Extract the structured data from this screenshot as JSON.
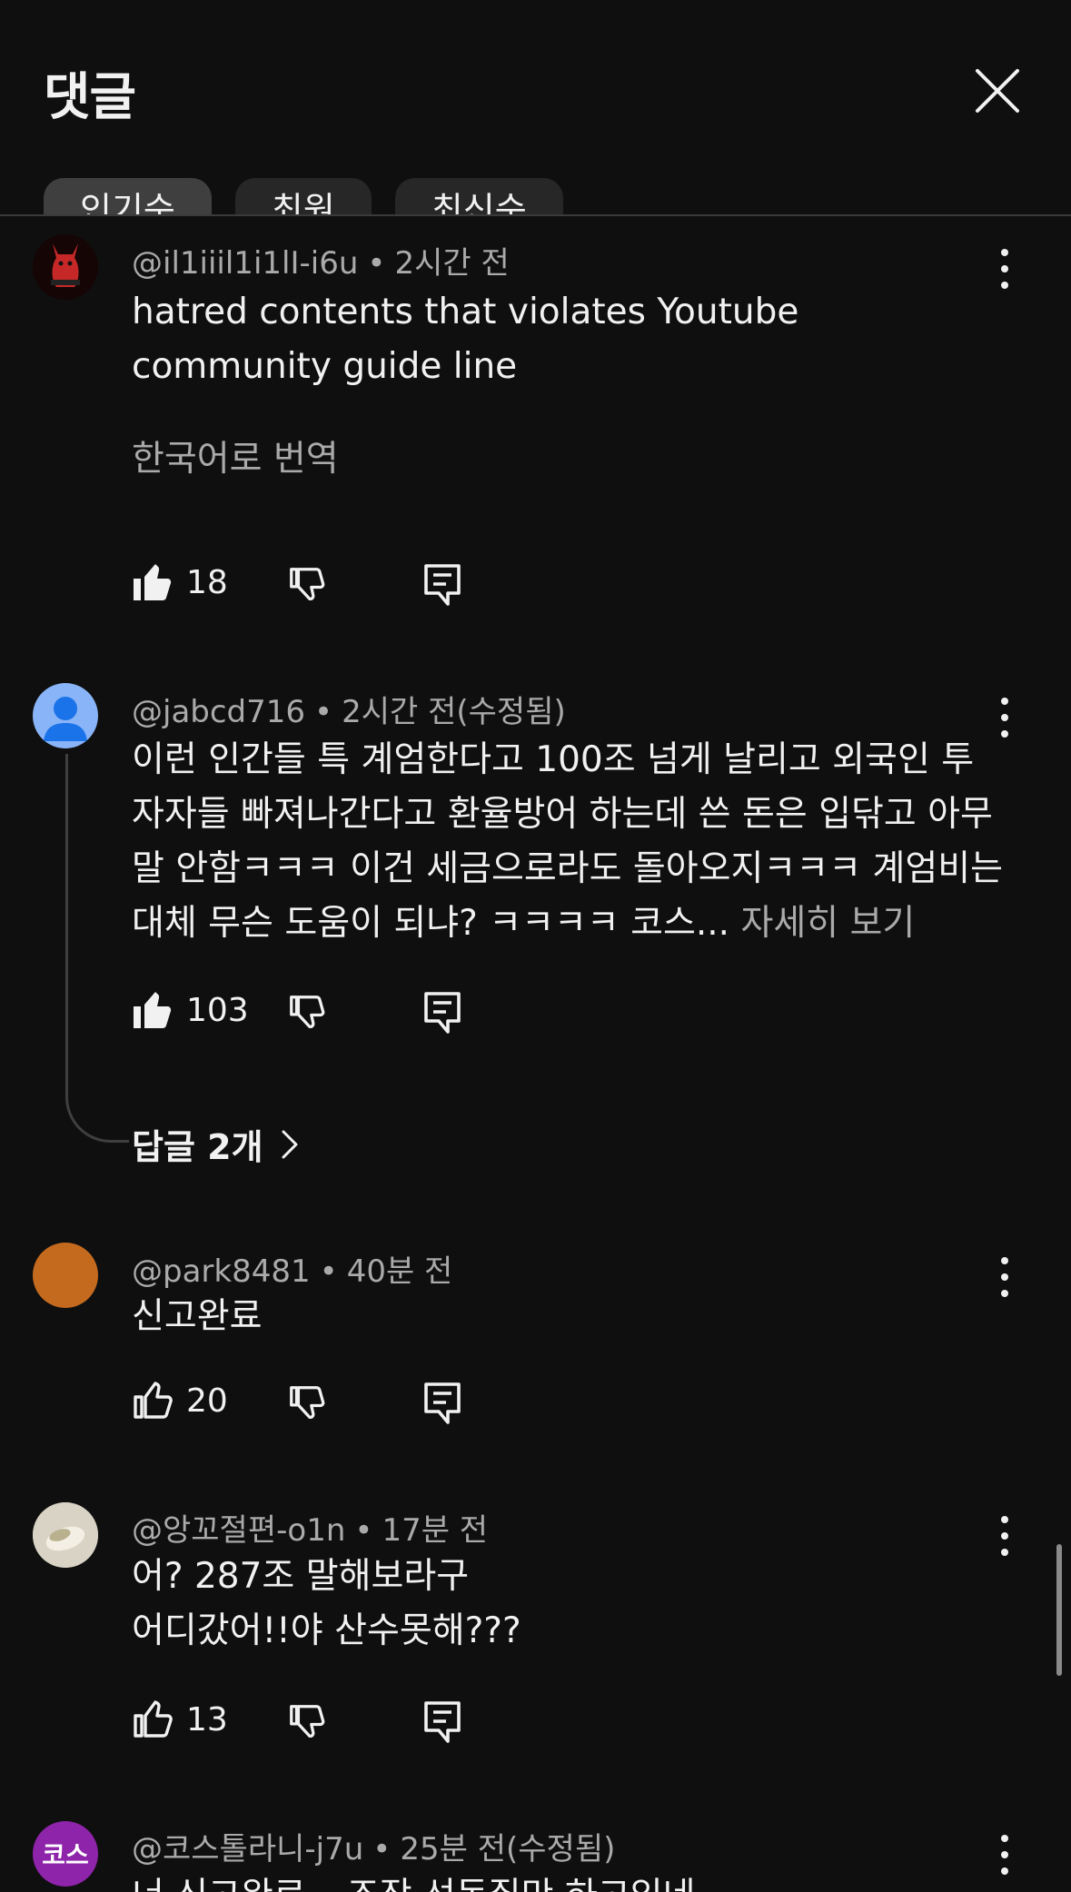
{
  "header": {
    "title": "댓글",
    "tabs": [
      "인기순",
      "최원",
      "최신순"
    ]
  },
  "comments": [
    {
      "handle": "@il1iiil1i1lI-i6u",
      "time": "2시간 전",
      "text": "hatred contents that violates Youtube community guide line",
      "translate": "한국어로 번역",
      "likes": "18"
    },
    {
      "handle": "@jabcd716",
      "time": "2시간 전(수정됨)",
      "text": "이런 인간들 특 계엄한다고 100조 넘게 날리고 외국인 투자자들 빠져나간다고 환율방어 하는데 쓴 돈은 입닦고 아무 말 안함ㅋㅋㅋ 이건 세금으로라도 돌아오지ㅋㅋㅋ 계엄비는 대체 무슨 도움이 되냐? ㅋㅋㅋㅋ 코스...",
      "more": "자세히 보기",
      "likes": "103",
      "replies": "답글 2개"
    },
    {
      "handle": "@park8481",
      "time": "40분 전",
      "text": "신고완료",
      "likes": "20"
    },
    {
      "handle": "@앙꼬절편-o1n",
      "time": "17분 전",
      "text": "어? 287조 말해보라구\n어디갔어!!야 산수못해???",
      "likes": "13"
    },
    {
      "handle": "@코스톨라니-j7u",
      "time": "25분 전(수정됨)",
      "avatar_text": "코스",
      "text": "너 신고완료~ 조작 선동질만 하고있네"
    }
  ],
  "colors": {
    "background": "#0f0f0f",
    "text": "#f1f1f1",
    "secondary": "#aaaaaa",
    "avatar_blue": "#8ab4f8",
    "avatar_orange": "#c46a1e",
    "avatar_purple": "#8e24aa"
  }
}
